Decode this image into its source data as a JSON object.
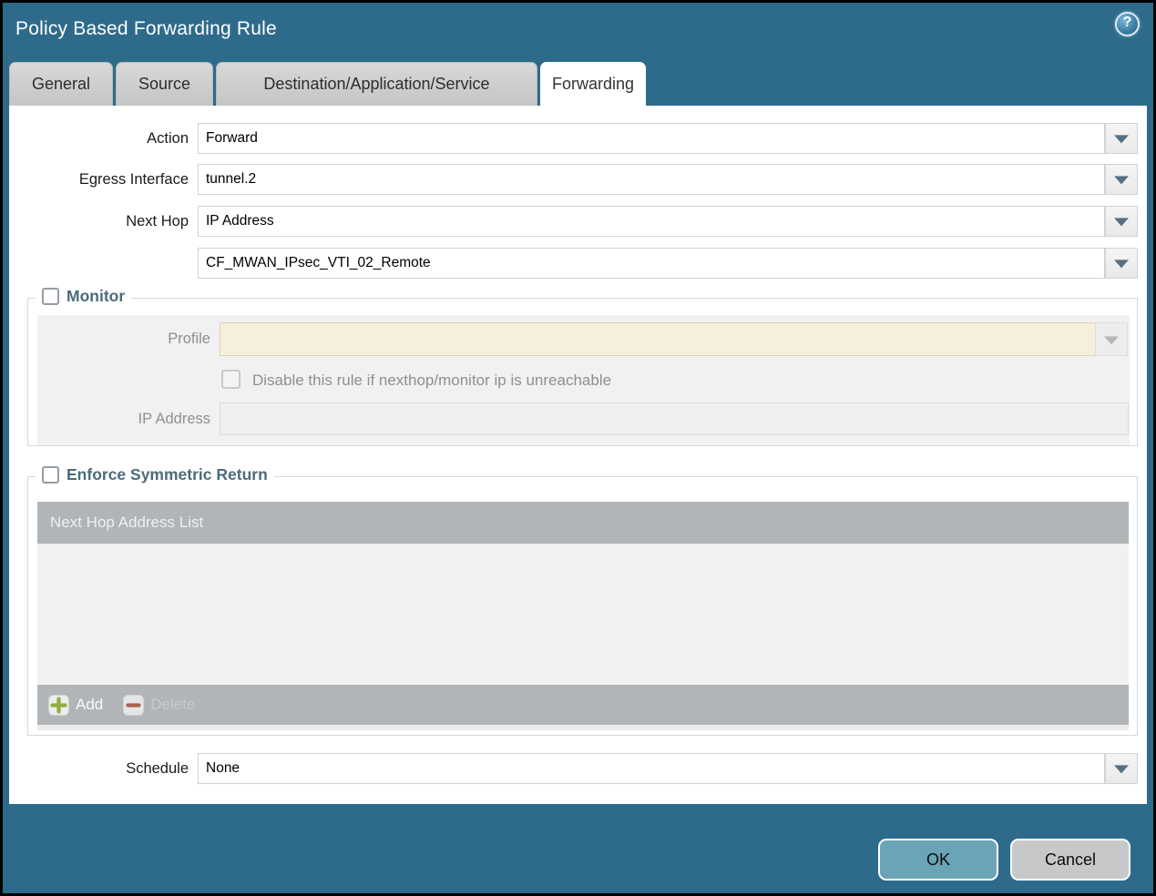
{
  "dialog": {
    "title": "Policy Based Forwarding Rule"
  },
  "tabs": [
    {
      "label": "General",
      "active": false
    },
    {
      "label": "Source",
      "active": false
    },
    {
      "label": "Destination/Application/Service",
      "active": false
    },
    {
      "label": "Forwarding",
      "active": true
    }
  ],
  "form": {
    "action": {
      "label": "Action",
      "value": "Forward"
    },
    "egress_interface": {
      "label": "Egress Interface",
      "value": "tunnel.2"
    },
    "next_hop": {
      "label": "Next Hop",
      "value": "IP Address"
    },
    "next_hop_address": {
      "value": "CF_MWAN_IPsec_VTI_02_Remote"
    },
    "schedule": {
      "label": "Schedule",
      "value": "None"
    }
  },
  "monitor": {
    "legend": "Monitor",
    "checked": false,
    "profile": {
      "label": "Profile",
      "value": ""
    },
    "disable_rule_checkbox": {
      "label": "Disable this rule if nexthop/monitor ip is unreachable",
      "checked": false
    },
    "ip_address": {
      "label": "IP Address",
      "value": ""
    }
  },
  "symmetric_return": {
    "legend": "Enforce Symmetric Return",
    "checked": false,
    "table": {
      "header": "Next Hop Address List",
      "rows": []
    },
    "add_label": "Add",
    "delete_label": "Delete",
    "delete_enabled": false
  },
  "footer": {
    "ok_label": "OK",
    "cancel_label": "Cancel"
  },
  "colors": {
    "titlebar_teal": "#2e6b8b",
    "ok_button": "#6ca4b7",
    "cancel_button": "#c6c8ca",
    "table_gray": "#b1b5b8",
    "profile_disabled_beige": "#f5efdc",
    "legend_text": "#4b6b7b",
    "add_plus_green": "#8fae3e",
    "delete_minus_red": "#a9604f"
  }
}
